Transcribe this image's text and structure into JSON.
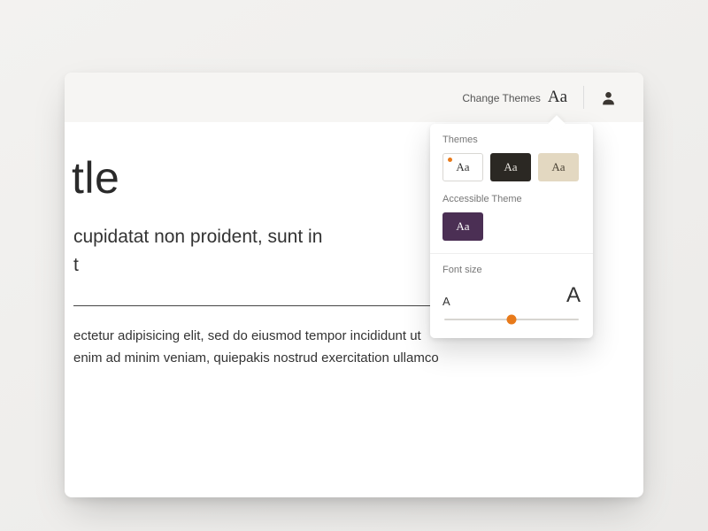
{
  "toolbar": {
    "change_themes_label": "Change Themes",
    "change_themes_glyph": "Aa"
  },
  "popover": {
    "themes_label": "Themes",
    "accessible_label": "Accessible Theme",
    "swatch_glyph": "Aa",
    "font_size_label": "Font size",
    "size_small_glyph": "A",
    "size_large_glyph": "A",
    "slider_percent": 50,
    "colors": {
      "active_dot": "#e87a1a",
      "slider_thumb": "#e87a1a"
    }
  },
  "doc": {
    "title": "tle",
    "lede_line1": "cupidatat non proident, sunt in",
    "lede_line2": "t",
    "body_line1": "ectetur adipisicing elit, sed do eiusmod tempor incididunt ut",
    "body_line2": "enim ad minim veniam, quiepakis nostrud exercitation ullamco"
  }
}
